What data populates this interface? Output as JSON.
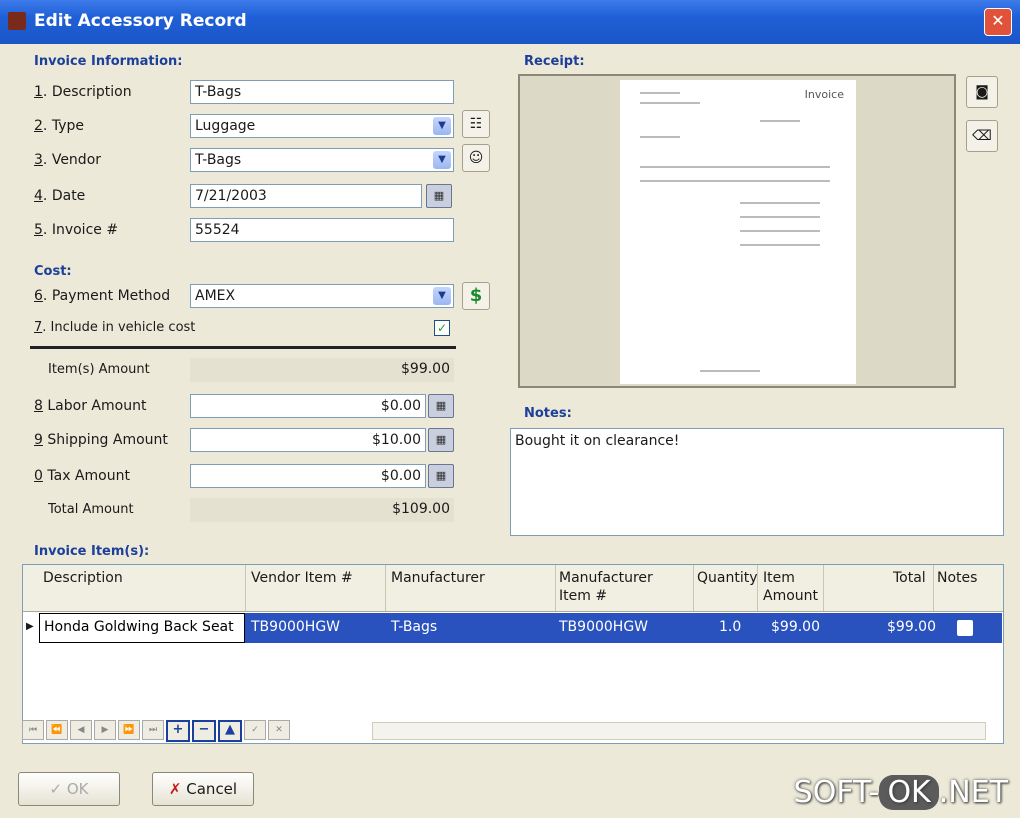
{
  "window": {
    "title": "Edit Accessory Record",
    "close": "✕"
  },
  "invoice_info": {
    "section_label": "Invoice Information:",
    "description": {
      "num": "1",
      "label": "Description",
      "value": "T-Bags"
    },
    "type": {
      "num": "2",
      "label": "Type",
      "value": "Luggage"
    },
    "vendor": {
      "num": "3",
      "label": "Vendor",
      "value": "T-Bags"
    },
    "date": {
      "num": "4",
      "label": "Date",
      "value": "7/21/2003"
    },
    "invoice_no": {
      "num": "5",
      "label": "Invoice #",
      "value": "55524"
    }
  },
  "cost": {
    "section_label": "Cost:",
    "payment_method": {
      "num": "6",
      "label": "Payment Method",
      "value": "AMEX"
    },
    "include": {
      "num": "7",
      "label": "Include in vehicle cost",
      "checked": true
    },
    "items_amount": {
      "label": "Item(s) Amount",
      "value": "$99.00"
    },
    "labor": {
      "num": "8",
      "label": "Labor Amount",
      "value": "$0.00"
    },
    "shipping": {
      "num": "9",
      "label": "Shipping Amount",
      "value": "$10.00"
    },
    "tax": {
      "num": "0",
      "label": "Tax Amount",
      "value": "$0.00"
    },
    "total": {
      "label": "Total Amount",
      "value": "$109.00"
    }
  },
  "receipt": {
    "section_label": "Receipt:",
    "doc_heading": "Invoice"
  },
  "notes": {
    "section_label": "Notes:",
    "value": "Bought it on clearance!"
  },
  "items": {
    "section_label": "Invoice Item(s):",
    "columns": [
      "Description",
      "Vendor Item #",
      "Manufacturer",
      "Manufacturer Item #",
      "Quantity",
      "Item Amount",
      "Total",
      "Notes"
    ],
    "rows": [
      {
        "description": "Honda Goldwing Back Seat",
        "vendor_item": "TB9000HGW",
        "manufacturer": "T-Bags",
        "mfr_item": "TB9000HGW",
        "quantity": "1.0",
        "item_amount": "$99.00",
        "total": "$99.00"
      }
    ],
    "nav": [
      "⏮",
      "⏪",
      "◀",
      "▶",
      "⏩",
      "⏭",
      "+",
      "−",
      "▲",
      "✓",
      "✕"
    ]
  },
  "buttons": {
    "ok": "OK",
    "cancel": "Cancel"
  },
  "watermark": {
    "prefix": "SOFT-",
    "mid": "OK",
    "suffix": ".NET"
  }
}
